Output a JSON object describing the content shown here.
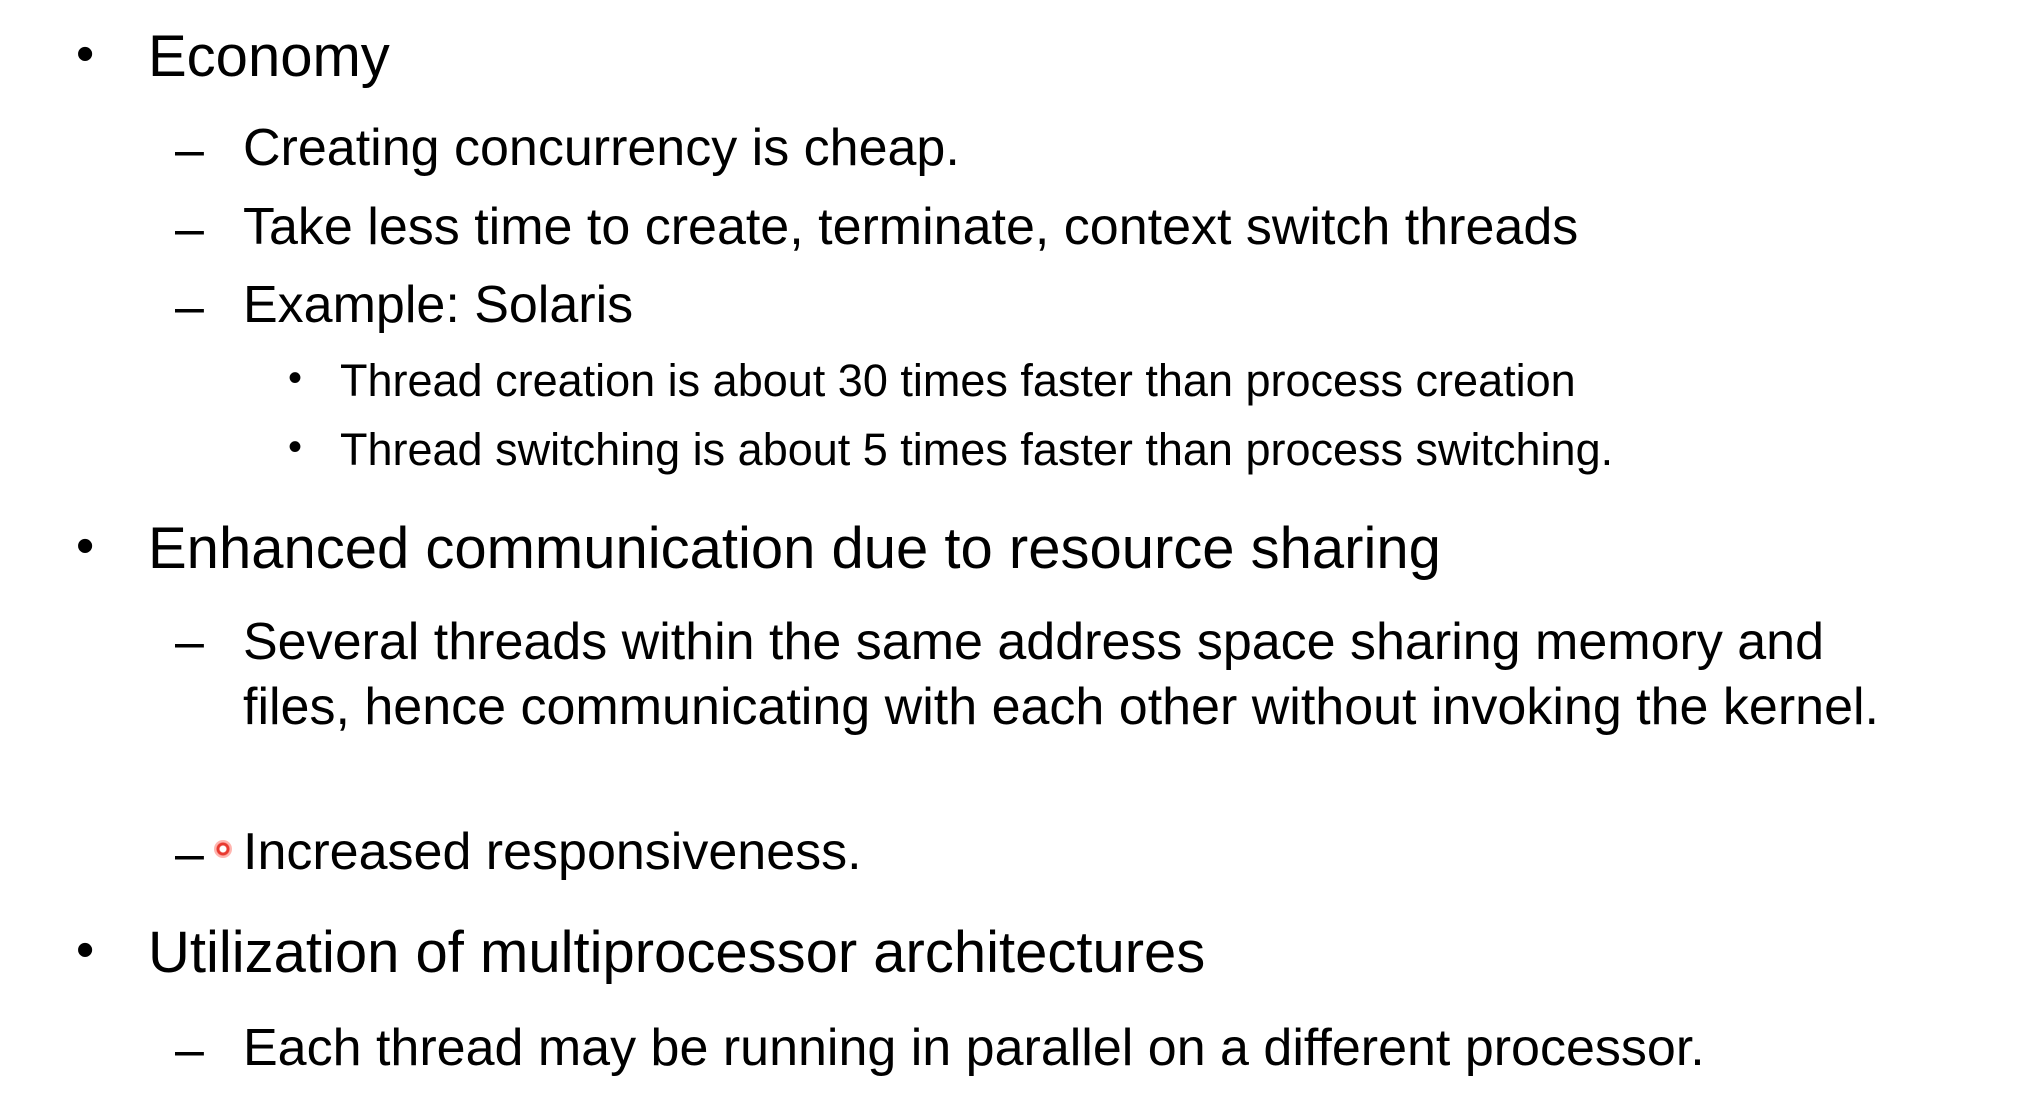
{
  "bullets": [
    {
      "title": "Economy",
      "subs": [
        "Creating concurrency is cheap.",
        "Take less time to create, terminate, context switch threads",
        "Example: Solaris"
      ],
      "subsubs": [
        "Thread creation is about 30 times faster than process creation",
        "Thread switching is about 5 times faster than process switching."
      ]
    },
    {
      "title": "Enhanced communication due to resource sharing",
      "subs": [
        "Several threads within the same address space sharing memory and files, hence communicating with each other without invoking the kernel.",
        "Increased responsiveness."
      ]
    },
    {
      "title": "Utilization of multiprocessor architectures",
      "subs": [
        "Each thread may be running in parallel on a different processor."
      ]
    }
  ],
  "markers": {
    "level1": "•",
    "level2": "–",
    "level3": "•"
  }
}
